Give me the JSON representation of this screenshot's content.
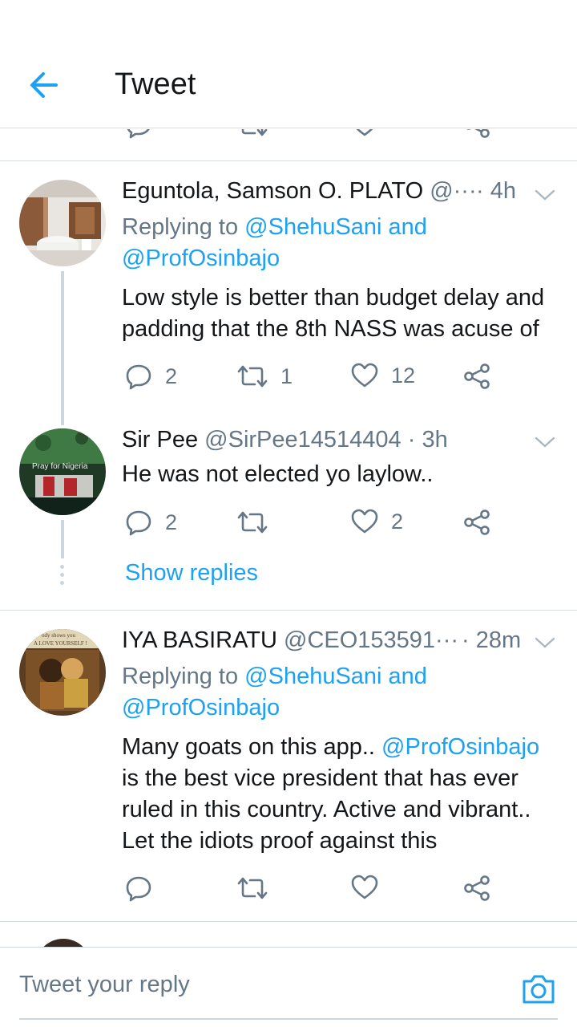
{
  "header": {
    "title": "Tweet"
  },
  "tweets": [
    {
      "name": "Eguntola, Samson O. PLATO",
      "handle": "@···",
      "time": "· 4h",
      "replying_prefix": "Replying to ",
      "replying_users": "@ShehuSani and",
      "replying_users2": "@ProfOsinbajo",
      "text_line1": "Low style is better than budget delay and",
      "text_line2": "padding that the 8th NASS was acuse of",
      "replies": "2",
      "retweets": "1",
      "likes": "12"
    },
    {
      "name": "Sir Pee",
      "handle": "@SirPee14514404",
      "time": "· 3h",
      "avatar_caption": "Pray for Nigeria",
      "text_line1": "He was not elected yo laylow..",
      "replies": "2",
      "retweets": "",
      "likes": "2"
    },
    {
      "name": "IYA BASIRATU",
      "handle": "@CEO153591···",
      "time": "· 28m",
      "avatar_caption_top": "ody shows you",
      "avatar_caption_bottom": "A LOVE YOURSELF !",
      "replying_prefix": "Replying to ",
      "replying_users": "@ShehuSani and",
      "replying_users2": "@ProfOsinbajo",
      "text_line1_a": "Many goats on this app.. ",
      "text_line1_link": "@ProfOsinbajo",
      "text_line2": "is the best vice president that has ever",
      "text_line3": "ruled in this country. Active and vibrant..",
      "text_line4": "Let the idiots proof against this",
      "replies": "",
      "retweets": "",
      "likes": ""
    }
  ],
  "show_replies_label": "Show replies",
  "reply_bar": {
    "placeholder": "Tweet your reply"
  },
  "colors": {
    "accent": "#1da1f2",
    "muted": "#657786",
    "text": "#14171a",
    "border": "#d6dbe0"
  },
  "icons": [
    "back-arrow-icon",
    "reply-icon",
    "retweet-icon",
    "like-icon",
    "share-icon",
    "chevron-down-icon",
    "camera-icon"
  ]
}
